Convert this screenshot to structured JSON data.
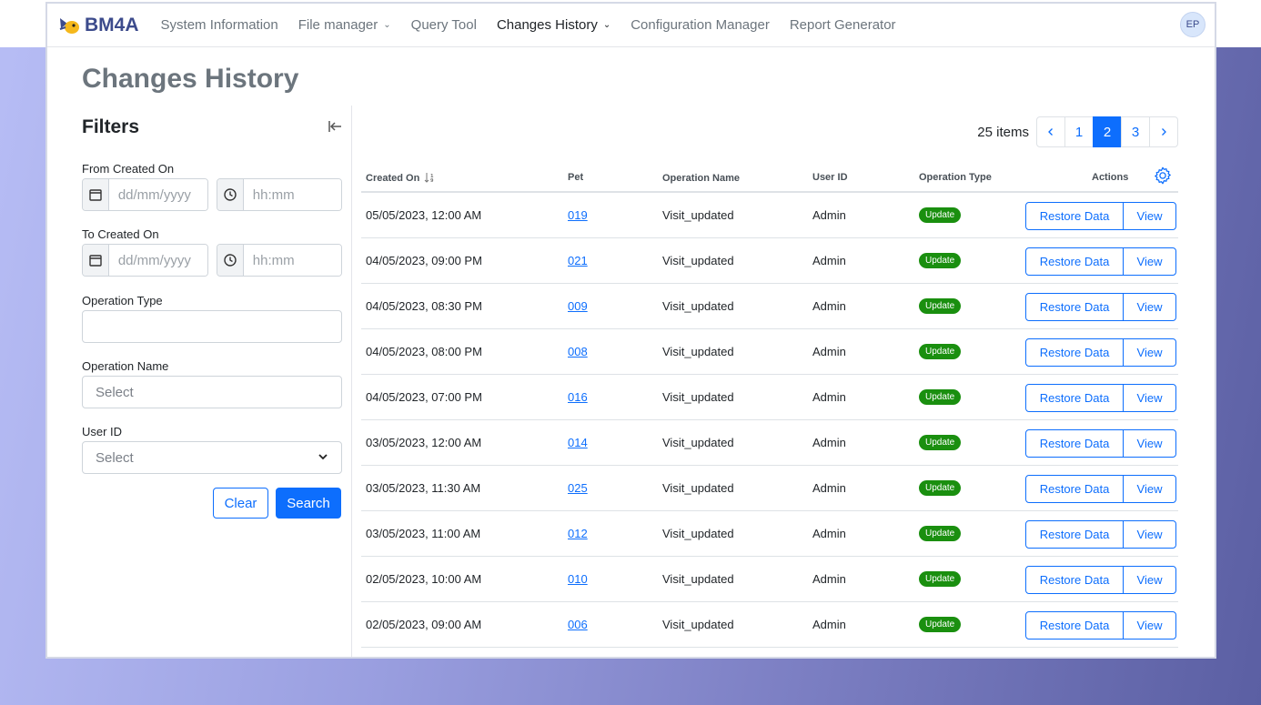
{
  "app": {
    "brand": "BM4A",
    "avatar_initials": "EP"
  },
  "nav": [
    {
      "label": "System Information",
      "dropdown": false,
      "active": false
    },
    {
      "label": "File manager",
      "dropdown": true,
      "active": false
    },
    {
      "label": "Query Tool",
      "dropdown": false,
      "active": false
    },
    {
      "label": "Changes History",
      "dropdown": true,
      "active": true
    },
    {
      "label": "Configuration Manager",
      "dropdown": false,
      "active": false
    },
    {
      "label": "Report Generator",
      "dropdown": false,
      "active": false
    }
  ],
  "page": {
    "title": "Changes History"
  },
  "filters": {
    "title": "Filters",
    "from_label": "From Created On",
    "to_label": "To Created On",
    "date_placeholder": "dd/mm/yyyy",
    "time_placeholder": "hh:mm",
    "operation_type_label": "Operation Type",
    "operation_type_value": "",
    "operation_name_label": "Operation Name",
    "operation_name_placeholder": "Select",
    "user_id_label": "User ID",
    "user_id_placeholder": "Select",
    "clear_label": "Clear",
    "search_label": "Search"
  },
  "pagination": {
    "items_text": "25 items",
    "pages": [
      "1",
      "2",
      "3"
    ],
    "active_page": "2"
  },
  "table": {
    "columns": {
      "created_on": "Created On",
      "pet": "Pet",
      "operation_name": "Operation Name",
      "user_id": "User ID",
      "operation_type": "Operation Type",
      "actions": "Actions"
    },
    "restore_label": "Restore Data",
    "view_label": "View",
    "rows": [
      {
        "created_on": "05/05/2023, 12:00 AM",
        "pet": "019",
        "operation_name": "Visit_updated",
        "user_id": "Admin",
        "operation_type": "Update"
      },
      {
        "created_on": "04/05/2023, 09:00 PM",
        "pet": "021",
        "operation_name": "Visit_updated",
        "user_id": "Admin",
        "operation_type": "Update"
      },
      {
        "created_on": "04/05/2023, 08:30 PM",
        "pet": "009",
        "operation_name": "Visit_updated",
        "user_id": "Admin",
        "operation_type": "Update"
      },
      {
        "created_on": "04/05/2023, 08:00 PM",
        "pet": "008",
        "operation_name": "Visit_updated",
        "user_id": "Admin",
        "operation_type": "Update"
      },
      {
        "created_on": "04/05/2023, 07:00 PM",
        "pet": "016",
        "operation_name": "Visit_updated",
        "user_id": "Admin",
        "operation_type": "Update"
      },
      {
        "created_on": "03/05/2023, 12:00 AM",
        "pet": "014",
        "operation_name": "Visit_updated",
        "user_id": "Admin",
        "operation_type": "Update"
      },
      {
        "created_on": "03/05/2023, 11:30 AM",
        "pet": "025",
        "operation_name": "Visit_updated",
        "user_id": "Admin",
        "operation_type": "Update"
      },
      {
        "created_on": "03/05/2023, 11:00 AM",
        "pet": "012",
        "operation_name": "Visit_updated",
        "user_id": "Admin",
        "operation_type": "Update"
      },
      {
        "created_on": "02/05/2023, 10:00 AM",
        "pet": "010",
        "operation_name": "Visit_updated",
        "user_id": "Admin",
        "operation_type": "Update"
      },
      {
        "created_on": "02/05/2023, 09:00 AM",
        "pet": "006",
        "operation_name": "Visit_updated",
        "user_id": "Admin",
        "operation_type": "Update"
      }
    ]
  },
  "colors": {
    "primary": "#0d6efd",
    "badge": "#1a8f0f",
    "brand": "#3c4b8c",
    "title": "#6c757d"
  },
  "icons": {
    "calendar": "calendar-icon",
    "clock": "clock-icon",
    "collapse": "collapse-left-icon",
    "sort": "sort-icon",
    "gear": "gear-icon",
    "chevron": "chevron-down-icon"
  }
}
